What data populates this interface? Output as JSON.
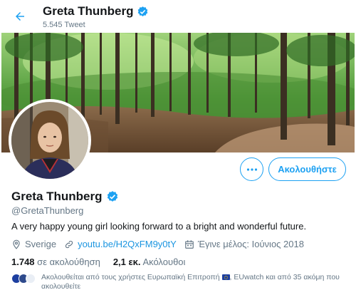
{
  "header": {
    "name": "Greta Thunberg",
    "tweet_count": "5.545 Tweet"
  },
  "profile": {
    "name": "Greta Thunberg",
    "handle": "@GretaThunberg",
    "bio": "A very happy young girl looking forward to a bright and wonderful future.",
    "location": "Sverige",
    "website": "youtu.be/H2QxFM9y0tY",
    "joined": "Έγινε μέλος: Ιούνιος 2018",
    "verified": true
  },
  "actions": {
    "follow_label": "Ακολουθήστε"
  },
  "stats": {
    "following_count": "1.748",
    "following_label": "σε ακολούθηση",
    "followers_count": "2,1 εκ.",
    "followers_label": "Ακόλουθοι"
  },
  "followed_by": {
    "part1": "Ακολουθείται από τους χρήστες Ευρωπαϊκή Επιτροπή",
    "part2": ", EUwatch και από 35 ακόμη που ακολουθείτε"
  },
  "colors": {
    "accent": "#1da1f2",
    "link": "#1b95e0",
    "secondary_text": "#657786",
    "primary_text": "#14171a"
  },
  "icons": {
    "back": "arrow-left-icon",
    "verified": "verified-badge-icon",
    "more": "more-horizontal-icon",
    "location": "location-pin-icon",
    "link": "link-icon",
    "calendar": "calendar-icon"
  }
}
